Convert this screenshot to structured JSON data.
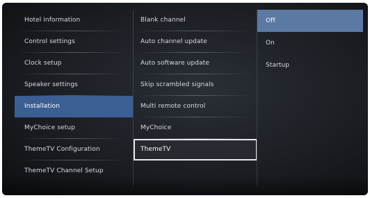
{
  "menu": {
    "left": [
      {
        "label": "Hotel information"
      },
      {
        "label": "Control settings"
      },
      {
        "label": "Clock setup"
      },
      {
        "label": "Speaker settings"
      },
      {
        "label": "Installation"
      },
      {
        "label": "MyChoice setup"
      },
      {
        "label": "ThemeTV Configuration"
      },
      {
        "label": "ThemeTV Channel Setup"
      }
    ],
    "middle": [
      {
        "label": "Blank channel"
      },
      {
        "label": "Auto channel update"
      },
      {
        "label": "Auto software update"
      },
      {
        "label": "Skip scrambled signals"
      },
      {
        "label": "Multi remote control"
      },
      {
        "label": "MyChoice"
      },
      {
        "label": "ThemeTV"
      }
    ],
    "right": [
      {
        "label": "Off"
      },
      {
        "label": "On"
      },
      {
        "label": "Startup"
      }
    ]
  },
  "colors": {
    "highlight": "#3b5f93",
    "selected_option": "#5b79a3",
    "focus_outline": "#e6e8ec"
  }
}
